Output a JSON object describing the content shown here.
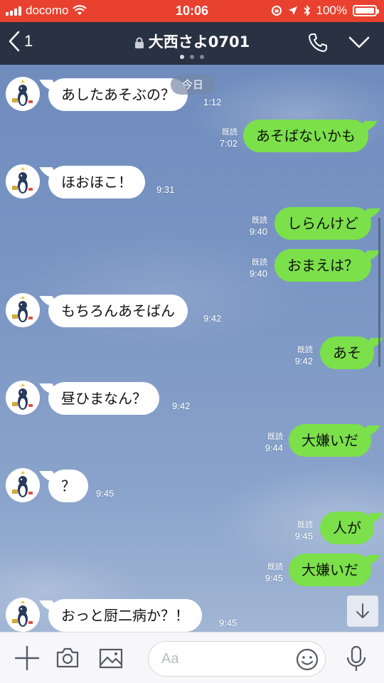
{
  "status_bar": {
    "carrier": "docomo",
    "time": "10:06",
    "battery": "100%"
  },
  "header": {
    "back_count": "1",
    "title": "大西さよ0701",
    "page_dots": 3,
    "active_dot": 0
  },
  "chat": {
    "date_label": "今日",
    "messages": [
      {
        "side": "in",
        "text": "あしたあそぶの？",
        "time": "1:12"
      },
      {
        "side": "out",
        "text": "あそばないかも",
        "read": "既読",
        "time": "7:02"
      },
      {
        "side": "in",
        "text": "ほおほこ！",
        "time": "9:31"
      },
      {
        "side": "out",
        "text": "しらんけど",
        "read": "既読",
        "time": "9:40"
      },
      {
        "side": "out",
        "text": "おまえは？",
        "read": "既読",
        "time": "9:40"
      },
      {
        "side": "in",
        "text": "もちろんあそばん",
        "time": "9:42"
      },
      {
        "side": "out",
        "text": "あそ",
        "read": "既読",
        "time": "9:42"
      },
      {
        "side": "in",
        "text": "昼ひまなん？",
        "time": "9:42"
      },
      {
        "side": "out",
        "text": "大嫌いだ",
        "read": "既読",
        "time": "9:44"
      },
      {
        "side": "in",
        "text": "？",
        "time": "9:45"
      },
      {
        "side": "out",
        "text": "人が",
        "read": "既読",
        "time": "9:45"
      },
      {
        "side": "out",
        "text": "大嫌いだ",
        "read": "既読",
        "time": "9:45"
      },
      {
        "side": "in",
        "text": "おっと厨二病か？！",
        "time": "9:45"
      }
    ]
  },
  "input_bar": {
    "placeholder": "Aa"
  },
  "icons": {
    "back": "chevron-left-icon",
    "lock": "lock-icon",
    "call": "phone-icon",
    "menu": "chevron-down-icon",
    "add": "plus-icon",
    "camera": "camera-icon",
    "photo": "image-icon",
    "emoji": "smiley-icon",
    "mic": "microphone-icon",
    "scroll_down": "arrow-down-icon"
  },
  "colors": {
    "status_bar": "#e8412f",
    "header": "#283243",
    "outgoing_bubble": "#7be04a",
    "incoming_bubble": "#ffffff"
  }
}
